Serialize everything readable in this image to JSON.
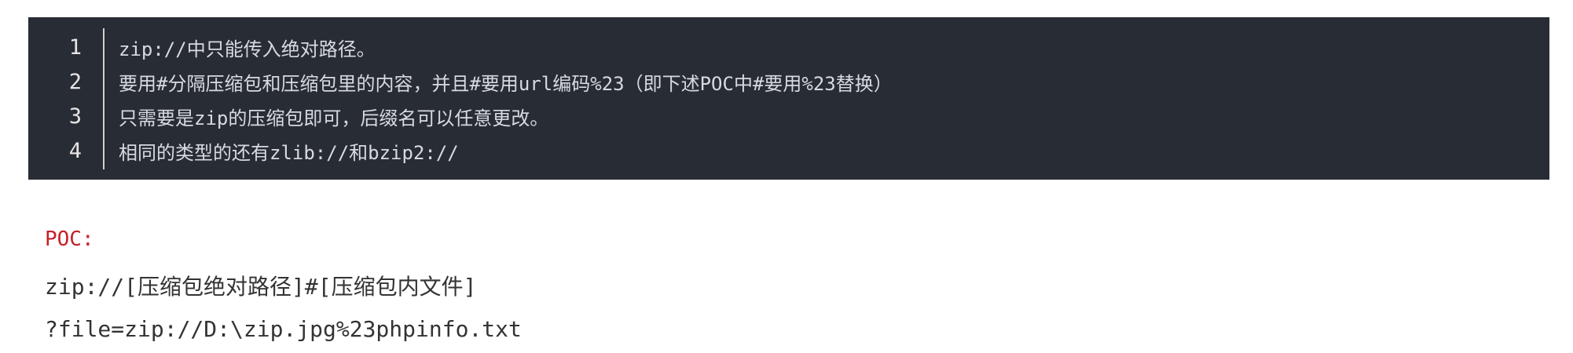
{
  "code_block": {
    "lines": [
      {
        "num": "1",
        "text": "zip://中只能传入绝对路径。"
      },
      {
        "num": "2",
        "text": "要用#分隔压缩包和压缩包里的内容，并且#要用url编码%23（即下述POC中#要用%23替换）"
      },
      {
        "num": "3",
        "text": "只需要是zip的压缩包即可，后缀名可以任意更改。"
      },
      {
        "num": "4",
        "text": "相同的类型的还有zlib://和bzip2://"
      }
    ]
  },
  "poc": {
    "label": "POC:",
    "line1": "zip://[压缩包绝对路径]#[压缩包内文件]",
    "line2": "?file=zip://D:\\zip.jpg%23phpinfo.txt"
  }
}
